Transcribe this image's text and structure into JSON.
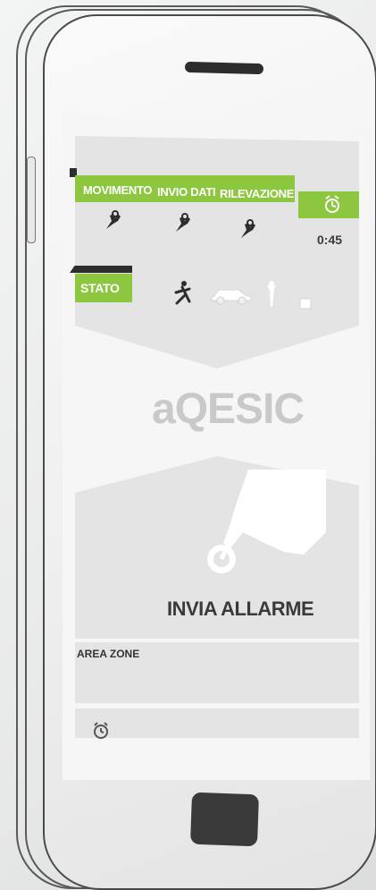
{
  "header_labels": {
    "movimento": "MOVIMENTO",
    "invio_dati": "INVIO DATI",
    "rilevazione": "RILEVAZIONE"
  },
  "timer": "0:45",
  "stato_label": "STATO",
  "logo": "aQESIC",
  "alarm_button_label": "INVIA ALLARME",
  "area_zone_label": "AREA ZONE",
  "colors": {
    "accent_green": "#8dc63f",
    "panel_gray": "#e4e4e4",
    "dark": "#2d2d2d"
  },
  "icons": [
    "ok-hand-icon",
    "alarm-clock-icon",
    "running-person-icon",
    "car-icon",
    "standing-person-icon",
    "box-icon",
    "pointing-hand-icon"
  ]
}
